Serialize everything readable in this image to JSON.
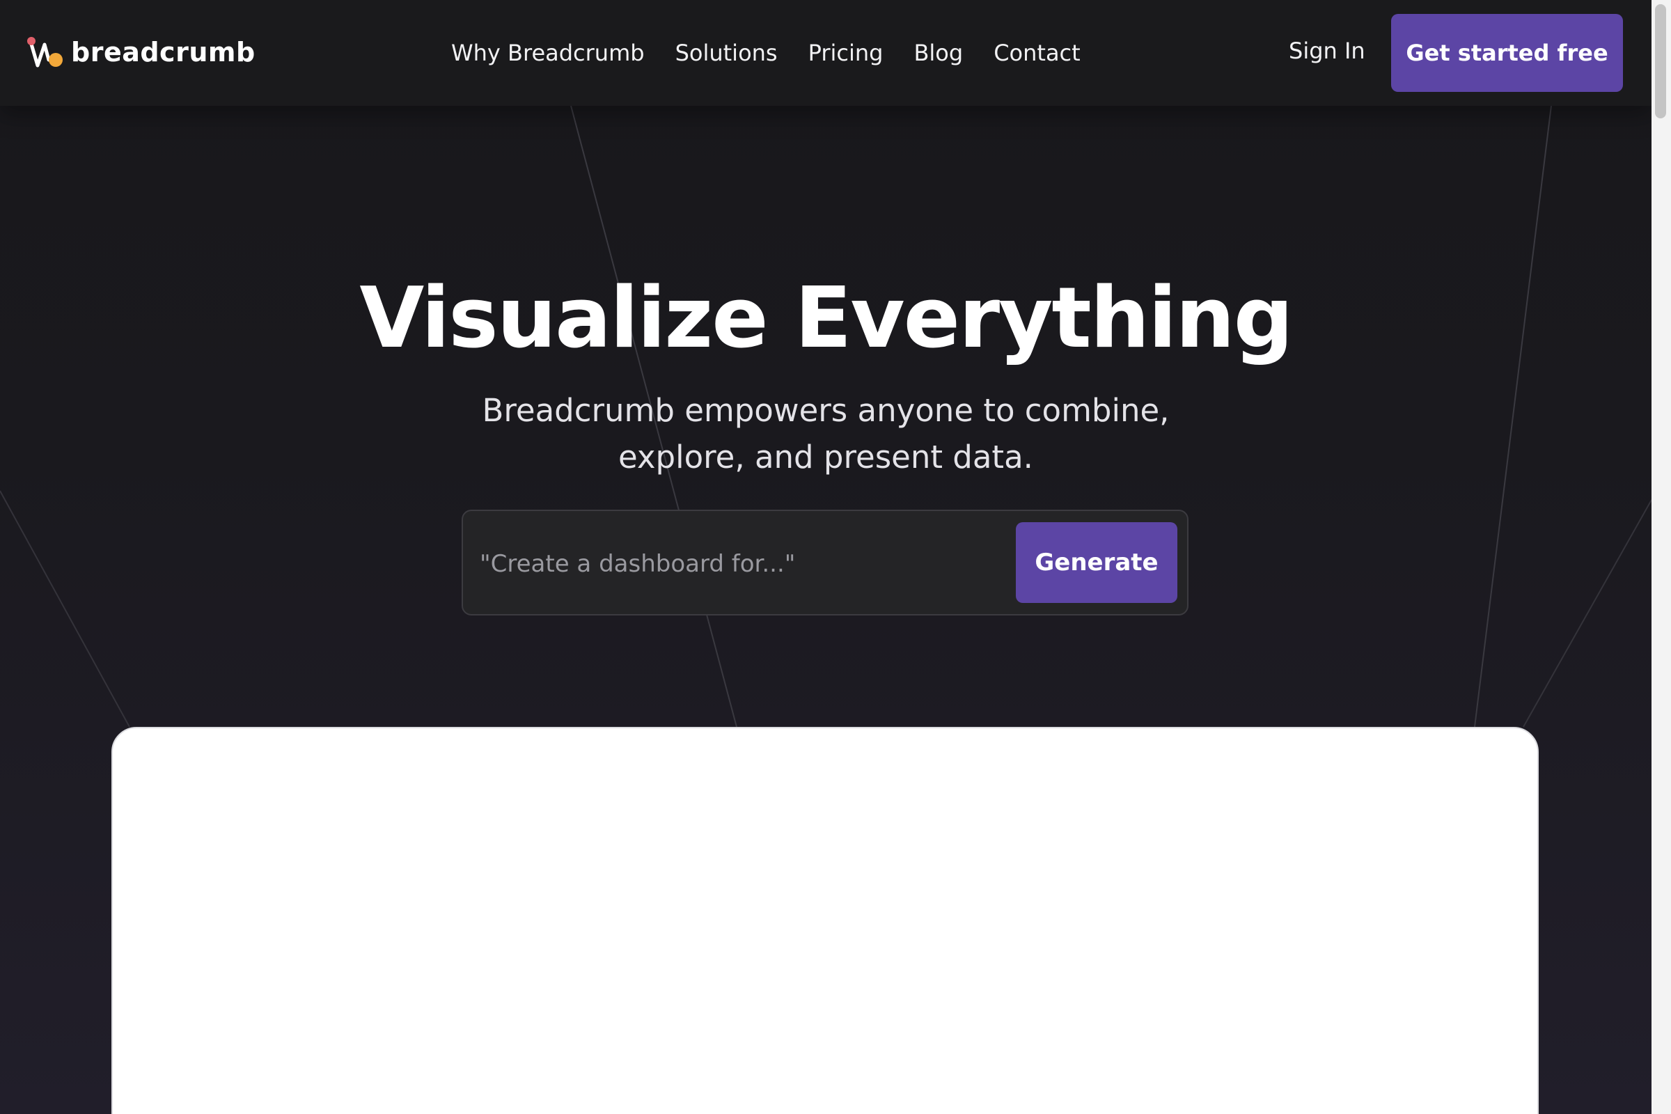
{
  "brand": {
    "name": "breadcrumb",
    "colors": {
      "accent": "#5c45a5",
      "logo_red": "#e0606a",
      "logo_orange": "#f2a83a"
    }
  },
  "nav": {
    "links": [
      "Why Breadcrumb",
      "Solutions",
      "Pricing",
      "Blog",
      "Contact"
    ],
    "sign_in": "Sign In",
    "cta": "Get started free"
  },
  "hero": {
    "title": "Visualize Everything",
    "subtitle_line1": "Breadcrumb empowers anyone to combine,",
    "subtitle_line2": "explore, and present data.",
    "prompt_placeholder": "\"Create a dashboard for...\"",
    "generate_label": "Generate"
  }
}
